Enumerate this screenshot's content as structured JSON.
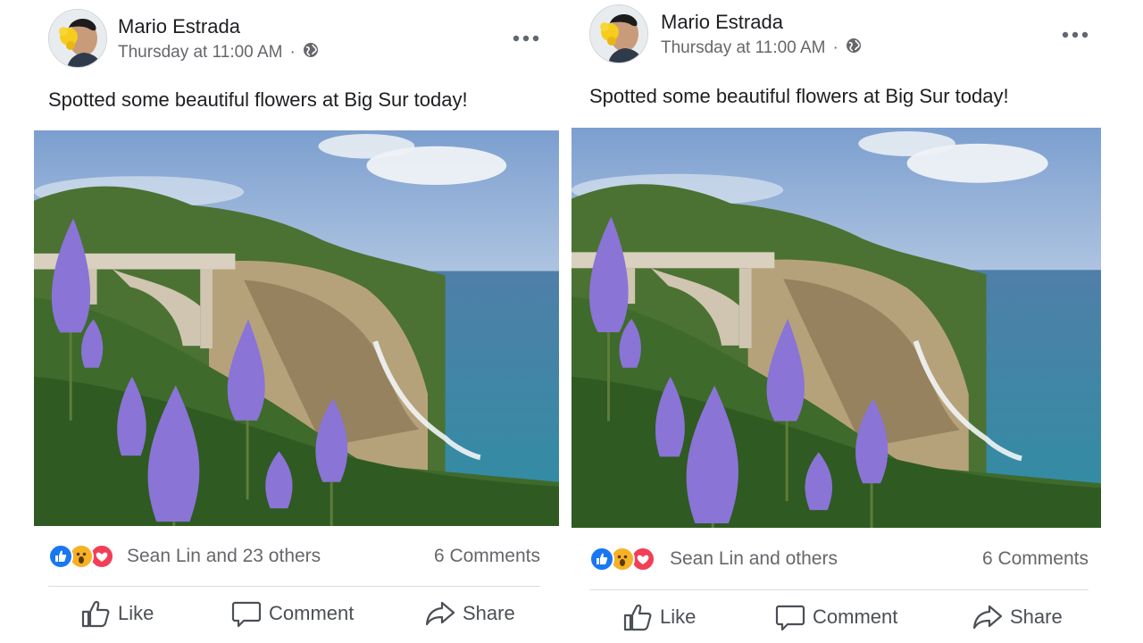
{
  "posts": [
    {
      "author": "Mario Estrada",
      "timestamp": "Thursday at 11:00 AM",
      "separator": "·",
      "privacy_icon": "globe-icon",
      "text": "Spotted some beautiful flowers at Big Sur today!",
      "reactions": [
        "like",
        "wow",
        "love"
      ],
      "likers": "Sean Lin and 23 others",
      "comments": "6 Comments",
      "actions": {
        "like": "Like",
        "comment": "Comment",
        "share": "Share"
      }
    },
    {
      "author": "Mario Estrada",
      "timestamp": "Thursday at 11:00 AM",
      "separator": "·",
      "privacy_icon": "globe-icon",
      "text": "Spotted some beautiful flowers at Big Sur today!",
      "reactions": [
        "like",
        "wow",
        "love"
      ],
      "likers": "Sean Lin and others",
      "comments": "6 Comments",
      "actions": {
        "like": "Like",
        "comment": "Comment",
        "share": "Share"
      }
    }
  ],
  "colors": {
    "like_blue": "#1877f2",
    "love_red": "#f33e58",
    "wow_yellow": "#f7b125",
    "secondary_text": "#65676b",
    "action_text": "#4b4f56"
  }
}
